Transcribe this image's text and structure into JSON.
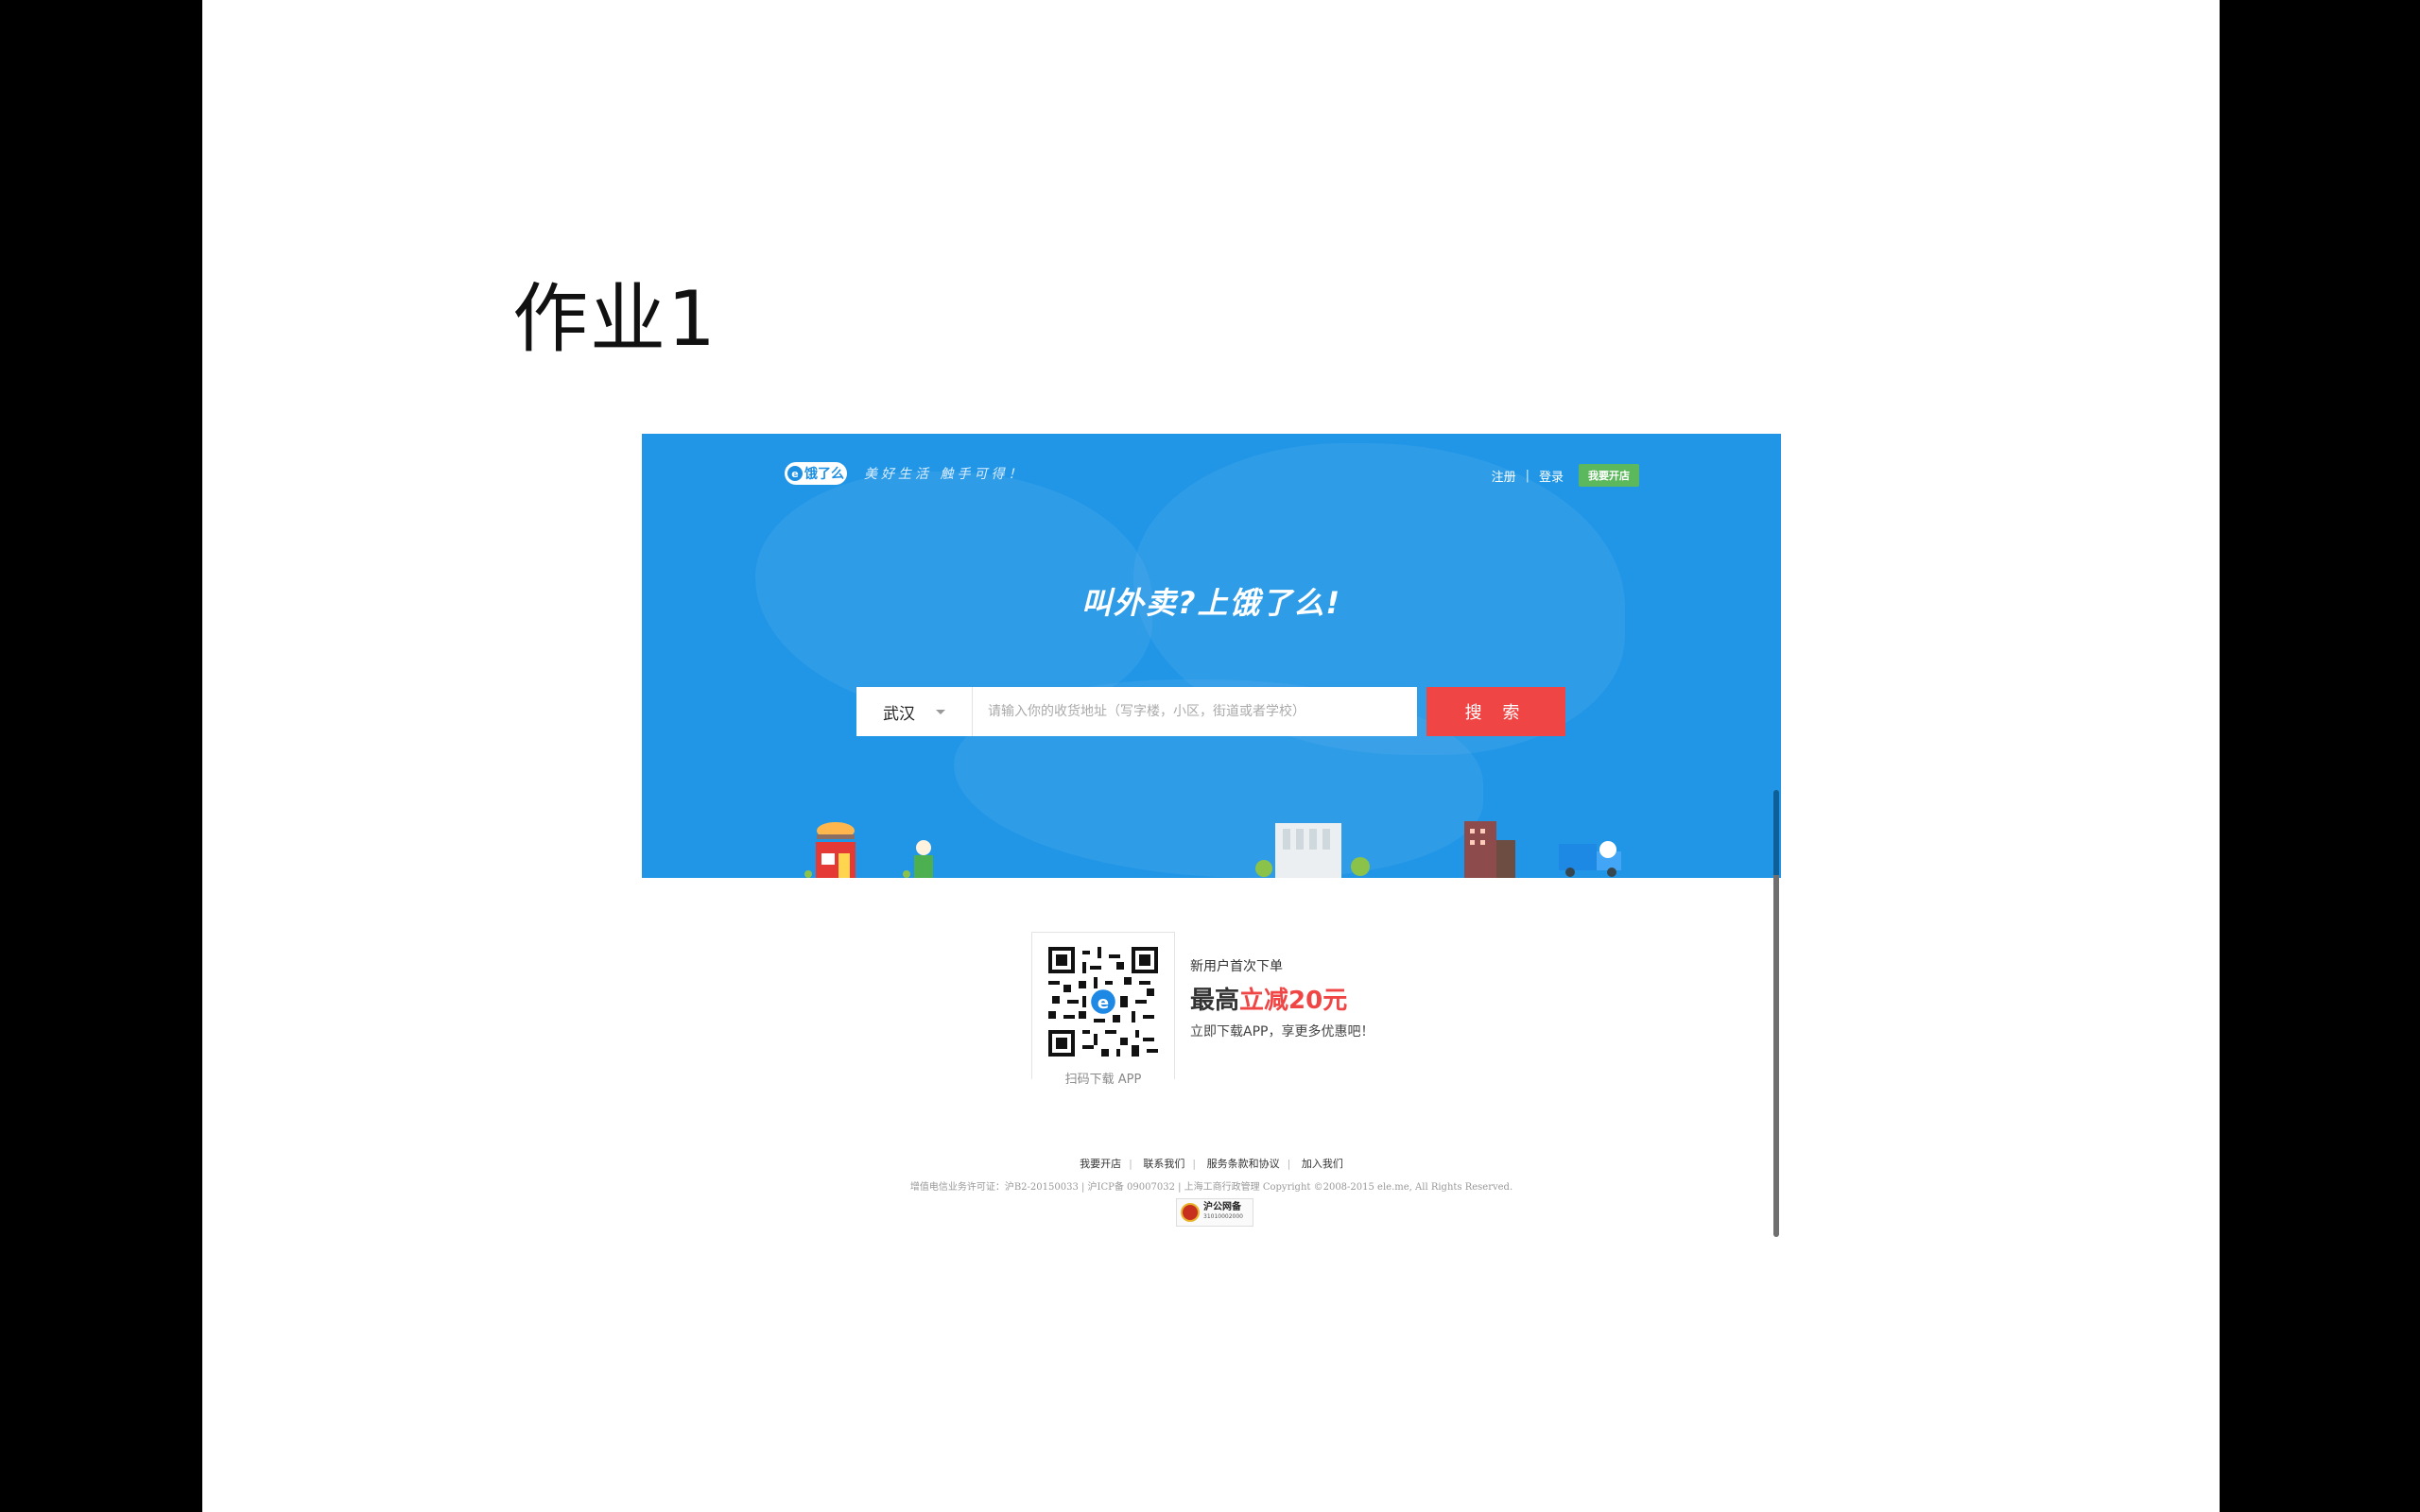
{
  "slide": {
    "title": "作业1"
  },
  "site": {
    "logo_text": "饿了么",
    "logo_mark": "e",
    "slogan": "美好生活 触手可得！",
    "nav": {
      "register": "注册",
      "separator": "|",
      "login": "登录",
      "open_store": "我要开店"
    },
    "headline": "叫外卖?上饿了么!",
    "search": {
      "city": "武汉",
      "placeholder": "请输入你的收货地址（写字楼，小区，街道或者学校）",
      "button": "搜 索"
    },
    "app_promo": {
      "qr_caption": "扫码下载 APP",
      "line1": "新用户首次下单",
      "line2_prefix": "最高",
      "line2_highlight": "立减20元",
      "line3": "立即下载APP，享更多优惠吧！"
    },
    "footer": {
      "links": [
        "我要开店",
        "联系我们",
        "服务条款和协议",
        "加入我们"
      ],
      "copyright": "增值电信业务许可证：沪B2-20150033 | 沪ICP备 09007032 | 上海工商行政管理 Copyright ©2008-2015 ele.me, All Rights Reserved.",
      "badge_title": "沪公网备",
      "badge_number": "31010002000"
    },
    "colors": {
      "hero_blue": "#2196e6",
      "search_red": "#f04545",
      "open_store_green": "#5cb85c",
      "promo_red": "#f04545"
    }
  }
}
